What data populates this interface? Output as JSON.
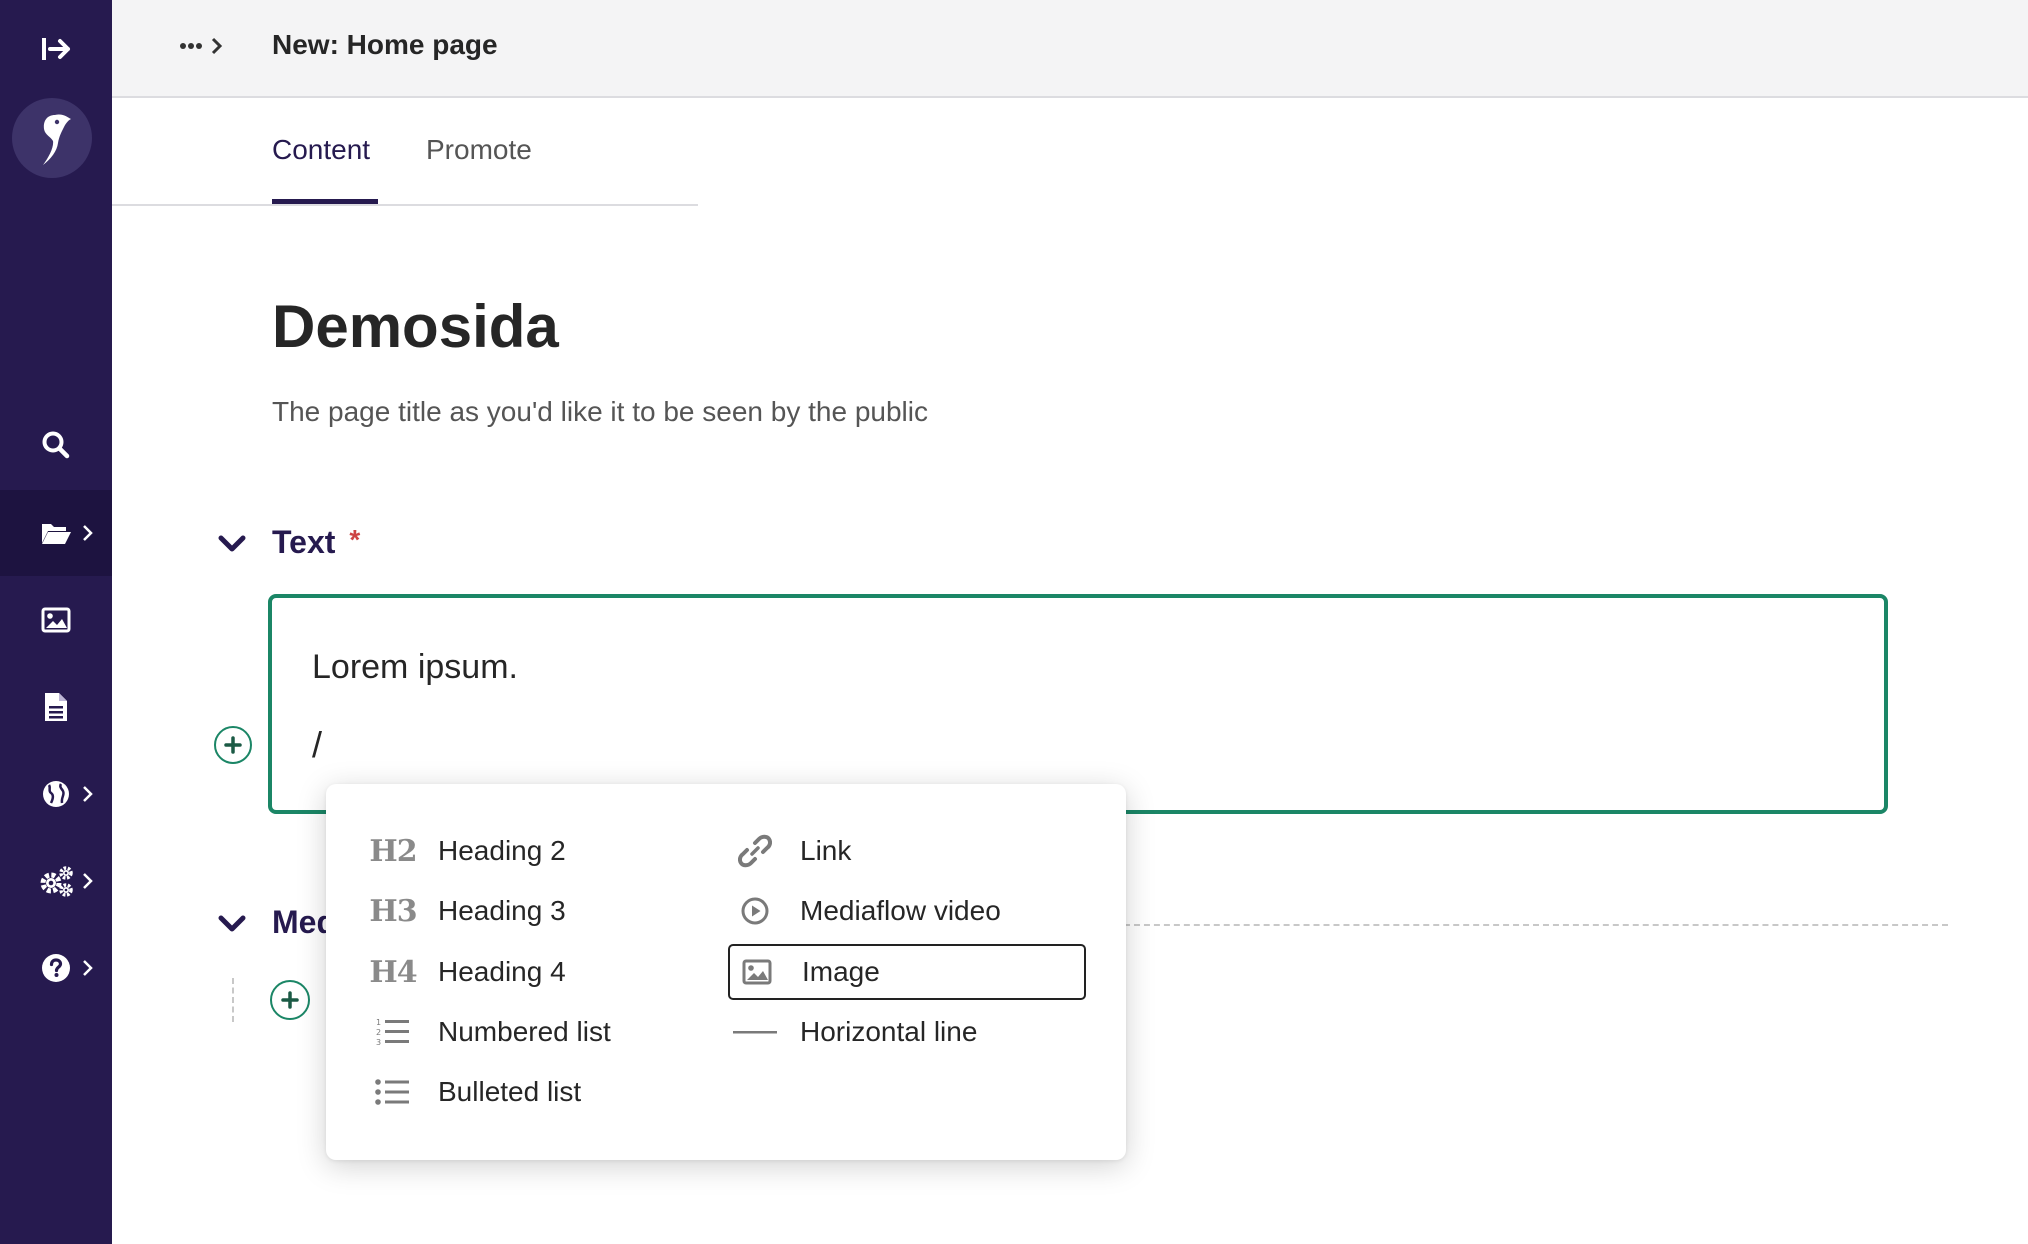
{
  "header": {
    "title": "New: Home page"
  },
  "tabs": [
    {
      "label": "Content",
      "active": true
    },
    {
      "label": "Promote",
      "active": false
    }
  ],
  "page": {
    "title": "Demosida",
    "help_text": "The page title as you'd like it to be seen by the public"
  },
  "sections": {
    "text": {
      "label": "Text",
      "required_mark": "*"
    },
    "media": {
      "label": "Med"
    }
  },
  "editor": {
    "line1": "Lorem ipsum.",
    "line2": "/"
  },
  "menu": {
    "left": [
      {
        "icon": "heading-2-icon",
        "icon_text": "H2",
        "label": "Heading 2"
      },
      {
        "icon": "heading-3-icon",
        "icon_text": "H3",
        "label": "Heading 3"
      },
      {
        "icon": "heading-4-icon",
        "icon_text": "H4",
        "label": "Heading 4"
      },
      {
        "icon": "numbered-list-icon",
        "label": "Numbered list"
      },
      {
        "icon": "bulleted-list-icon",
        "label": "Bulleted list"
      }
    ],
    "right": [
      {
        "icon": "link-icon",
        "label": "Link"
      },
      {
        "icon": "play-circle-icon",
        "label": "Mediaflow video"
      },
      {
        "icon": "image-icon",
        "label": "Image",
        "selected": true
      },
      {
        "icon": "horizontal-line-icon",
        "label": "Horizontal line"
      }
    ]
  },
  "sidebar": {
    "items": [
      {
        "icon": "search-icon"
      },
      {
        "icon": "folder-icon",
        "has_submenu": true,
        "active": true
      },
      {
        "icon": "image-icon"
      },
      {
        "icon": "document-icon"
      },
      {
        "icon": "globe-icon",
        "has_submenu": true
      },
      {
        "icon": "cogs-icon",
        "has_submenu": true
      },
      {
        "icon": "help-icon",
        "has_submenu": true
      }
    ]
  },
  "colors": {
    "sidebar_bg": "#261a4f",
    "accent_green": "#1b8666",
    "primary_text": "#261a4f",
    "required_red": "#cd4444"
  }
}
